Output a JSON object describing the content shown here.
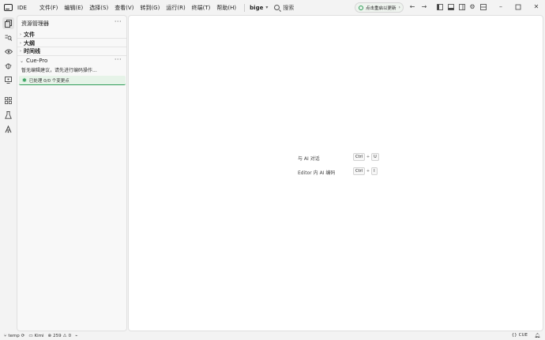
{
  "titlebar": {
    "app_label": "IDE",
    "menus": [
      "文件(F)",
      "编辑(E)",
      "选择(S)",
      "查看(V)",
      "转到(G)",
      "运行(R)",
      "终端(T)",
      "帮助(H)"
    ],
    "project": "bige",
    "search_label": "搜索",
    "update_label": "点击重启以更新"
  },
  "sidebar": {
    "explorer_title": "资源管理器",
    "sections": [
      "文件",
      "大纲",
      "时间线"
    ],
    "cue": {
      "title": "Cue-Pro",
      "message": "暂无编辑建议，请先进行编码操作...",
      "status": "已处理 0/0 个变更点"
    }
  },
  "editor": {
    "hints": [
      {
        "label": "与 AI 对话",
        "keys": [
          "Ctrl",
          "U"
        ]
      },
      {
        "label": "Editor 内 AI 编码",
        "keys": [
          "Ctrl",
          "I"
        ]
      }
    ]
  },
  "statusbar": {
    "branch": "temp",
    "model": "Kimi",
    "errors": "259",
    "warnings": "0",
    "language": "CUE"
  }
}
